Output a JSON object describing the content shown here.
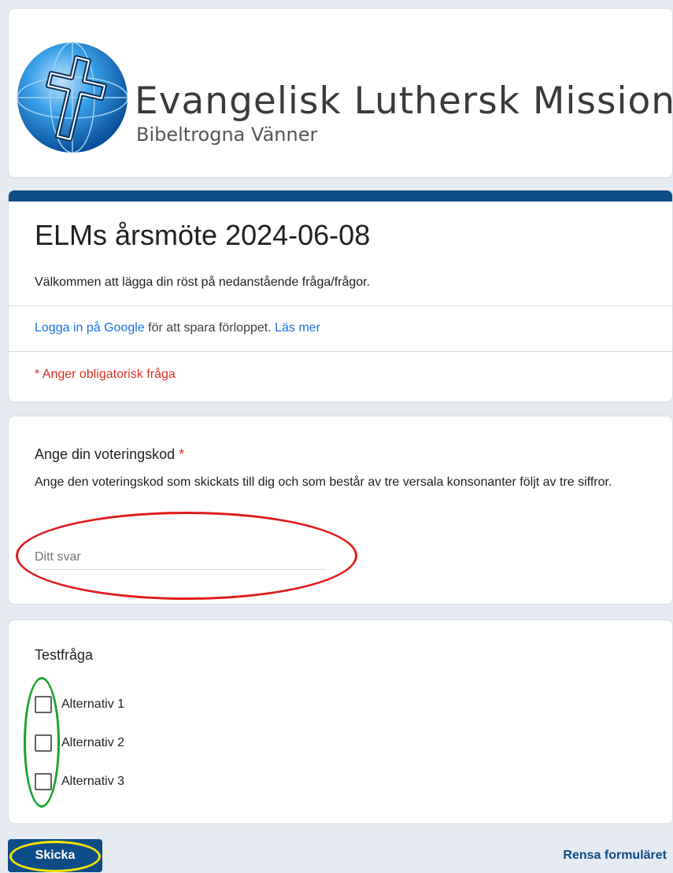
{
  "header": {
    "org_name": "Evangelisk Luthersk Mission",
    "org_subtitle": "Bibeltrogna Vänner",
    "logo_icon": "globe-cross-logo",
    "brand_color": "#0d4d87"
  },
  "form": {
    "title": "ELMs årsmöte 2024-06-08",
    "description": "Välkommen att lägga din röst på nedanstående fråga/frågor.",
    "signin_link": "Logga in på Google",
    "signin_text": " för att spara förloppet. ",
    "learn_more": "Läs mer",
    "required_note": "* Anger obligatorisk fråga"
  },
  "questions": [
    {
      "title": "Ange din voteringskod",
      "required_marker": "*",
      "description": "Ange den voteringskod som skickats till dig och som består av tre versala konsonanter följt av tre siffror.",
      "placeholder": "Ditt svar",
      "value": ""
    },
    {
      "title": "Testfråga",
      "options": [
        "Alternativ 1",
        "Alternativ 2",
        "Alternativ 3"
      ]
    }
  ],
  "footer": {
    "submit_label": "Skicka",
    "clear_label": "Rensa formuläret"
  },
  "annotation_colors": {
    "input": "#e01a1a",
    "checkboxes": "#1aa32d",
    "submit": "#f5e500"
  }
}
